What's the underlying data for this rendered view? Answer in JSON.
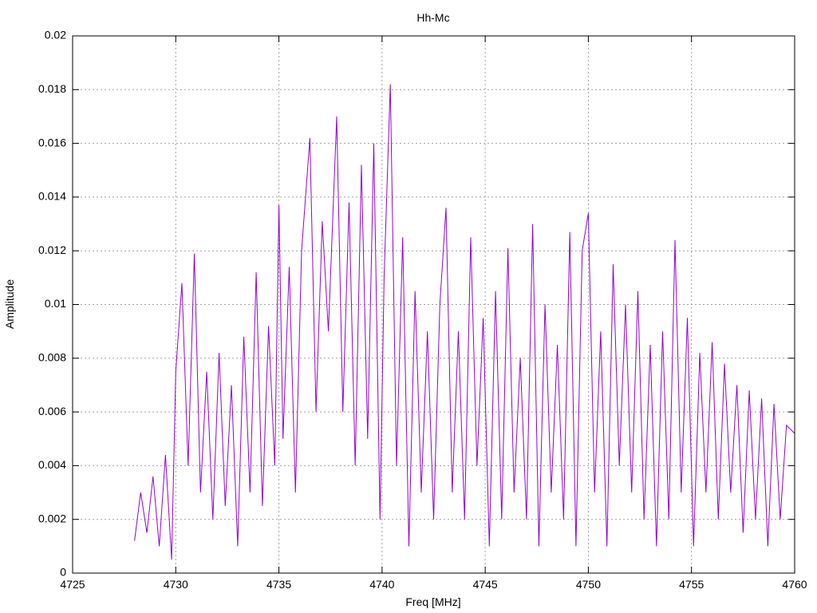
{
  "chart_data": {
    "type": "line",
    "title": "Hh-Mc",
    "xlabel": "Freq [MHz]",
    "ylabel": "Amplitude",
    "xlim": [
      4725,
      4760
    ],
    "ylim": [
      0,
      0.02
    ],
    "x_ticks": [
      4725,
      4730,
      4735,
      4740,
      4745,
      4750,
      4755,
      4760
    ],
    "y_ticks": [
      "0",
      "0.002",
      "0.004",
      "0.006",
      "0.008",
      "0.01",
      "0.012",
      "0.014",
      "0.016",
      "0.018",
      "0.02"
    ],
    "grid": true,
    "color": "#9400d3",
    "series": [
      {
        "x": [
          4728.0,
          4728.3,
          4728.6,
          4728.9,
          4729.2,
          4729.5,
          4729.8,
          4730.0,
          4730.3,
          4730.6,
          4730.9,
          4731.2,
          4731.5,
          4731.8,
          4732.1,
          4732.4,
          4732.7,
          4733.0,
          4733.3,
          4733.6,
          4733.9,
          4734.2,
          4734.5,
          4734.8,
          4735.0,
          4735.2,
          4735.5,
          4735.8,
          4736.1,
          4736.5,
          4736.8,
          4737.1,
          4737.4,
          4737.8,
          4738.1,
          4738.4,
          4738.7,
          4739.0,
          4739.3,
          4739.6,
          4739.9,
          4740.1,
          4740.4,
          4740.7,
          4741.0,
          4741.3,
          4741.6,
          4741.9,
          4742.2,
          4742.5,
          4742.8,
          4743.1,
          4743.4,
          4743.7,
          4744.0,
          4744.3,
          4744.6,
          4744.9,
          4745.2,
          4745.5,
          4745.8,
          4746.1,
          4746.4,
          4746.7,
          4747.0,
          4747.3,
          4747.6,
          4747.9,
          4748.2,
          4748.5,
          4748.8,
          4749.1,
          4749.4,
          4749.7,
          4750.0,
          4750.3,
          4750.6,
          4750.9,
          4751.2,
          4751.5,
          4751.8,
          4752.1,
          4752.4,
          4752.7,
          4753.0,
          4753.3,
          4753.6,
          4753.9,
          4754.2,
          4754.5,
          4754.8,
          4755.1,
          4755.4,
          4755.7,
          4756.0,
          4756.3,
          4756.6,
          4756.9,
          4757.2,
          4757.5,
          4757.8,
          4758.1,
          4758.4,
          4758.7,
          4759.0,
          4759.3,
          4759.6,
          4760.0
        ],
        "y": [
          0.0012,
          0.003,
          0.0015,
          0.0036,
          0.001,
          0.0044,
          0.0005,
          0.0075,
          0.0108,
          0.004,
          0.0119,
          0.003,
          0.0075,
          0.002,
          0.0082,
          0.0025,
          0.007,
          0.001,
          0.0088,
          0.003,
          0.0112,
          0.0025,
          0.0092,
          0.004,
          0.0137,
          0.005,
          0.0114,
          0.003,
          0.012,
          0.0162,
          0.006,
          0.0131,
          0.009,
          0.017,
          0.006,
          0.0138,
          0.004,
          0.0152,
          0.005,
          0.016,
          0.002,
          0.011,
          0.0182,
          0.004,
          0.0125,
          0.001,
          0.0105,
          0.003,
          0.009,
          0.002,
          0.01,
          0.0136,
          0.003,
          0.009,
          0.002,
          0.0125,
          0.004,
          0.0095,
          0.001,
          0.0105,
          0.002,
          0.0121,
          0.003,
          0.008,
          0.002,
          0.013,
          0.001,
          0.01,
          0.003,
          0.0085,
          0.002,
          0.0127,
          0.001,
          0.012,
          0.0134,
          0.003,
          0.009,
          0.001,
          0.0115,
          0.004,
          0.01,
          0.003,
          0.0105,
          0.002,
          0.0085,
          0.001,
          0.009,
          0.002,
          0.0124,
          0.003,
          0.0095,
          0.001,
          0.0082,
          0.003,
          0.0086,
          0.002,
          0.0078,
          0.003,
          0.007,
          0.0015,
          0.0068,
          0.002,
          0.0065,
          0.001,
          0.0063,
          0.002,
          0.0055,
          0.0052
        ]
      }
    ]
  }
}
